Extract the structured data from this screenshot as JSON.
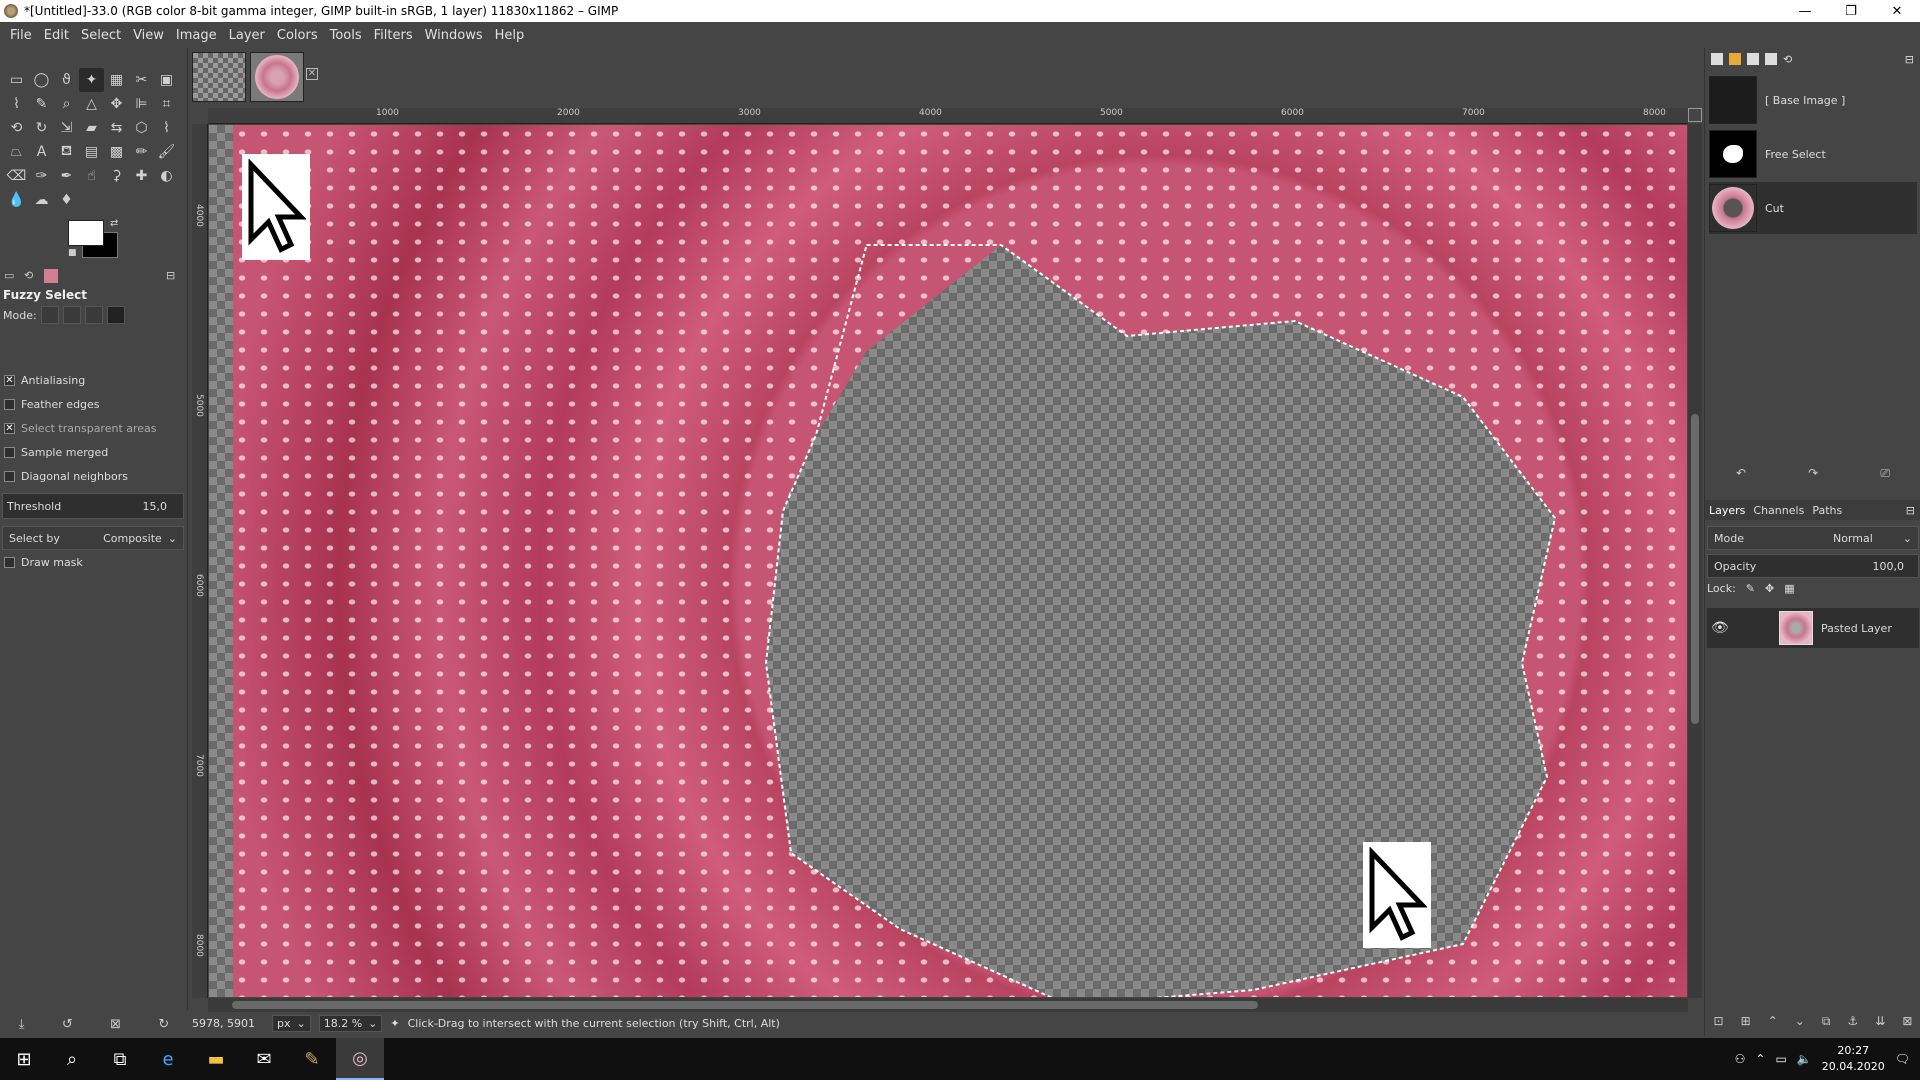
{
  "window": {
    "title": "*[Untitled]-33.0 (RGB color 8-bit gamma integer, GIMP built-in sRGB, 1 layer) 11830x11862 – GIMP",
    "minimize": "—",
    "maximize": "❐",
    "close": "✕"
  },
  "menu": [
    "File",
    "Edit",
    "Select",
    "View",
    "Image",
    "Layer",
    "Colors",
    "Tools",
    "Filters",
    "Windows",
    "Help"
  ],
  "tool_options": {
    "title": "Fuzzy Select",
    "mode_label": "Mode:",
    "checks": [
      {
        "label": "Antialiasing",
        "checked": "✕"
      },
      {
        "label": "Feather edges",
        "checked": ""
      },
      {
        "label": "Select transparent areas",
        "checked": "✕"
      },
      {
        "label": "Sample merged",
        "checked": ""
      },
      {
        "label": "Diagonal neighbors",
        "checked": ""
      }
    ],
    "threshold_label": "Threshold",
    "threshold_value": "15,0",
    "select_by_label": "Select by",
    "select_by_value": "Composite",
    "draw_mask_label": "Draw mask"
  },
  "rulers": {
    "h_labels": [
      "1000",
      "2000",
      "3000",
      "4000",
      "5000",
      "6000",
      "7000",
      "8000"
    ],
    "v_labels": [
      "4000",
      "5000",
      "6000",
      "7000",
      "8000"
    ]
  },
  "statusbar": {
    "coords": "5978, 5901",
    "unit": "px",
    "zoom": "18.2 %",
    "message": "Click-Drag to intersect with the current selection (try Shift, Ctrl, Alt)"
  },
  "undo_history": [
    {
      "label": "[ Base Image ]"
    },
    {
      "label": "Free Select"
    },
    {
      "label": "Cut"
    }
  ],
  "layers_panel": {
    "tabs": [
      "Layers",
      "Channels",
      "Paths"
    ],
    "mode_label": "Mode",
    "mode_value": "Normal",
    "opacity_label": "Opacity",
    "opacity_value": "100,0",
    "lock_label": "Lock:",
    "layer_name": "Pasted Layer"
  },
  "taskbar": {
    "time": "20:27",
    "date": "20.04.2020"
  }
}
